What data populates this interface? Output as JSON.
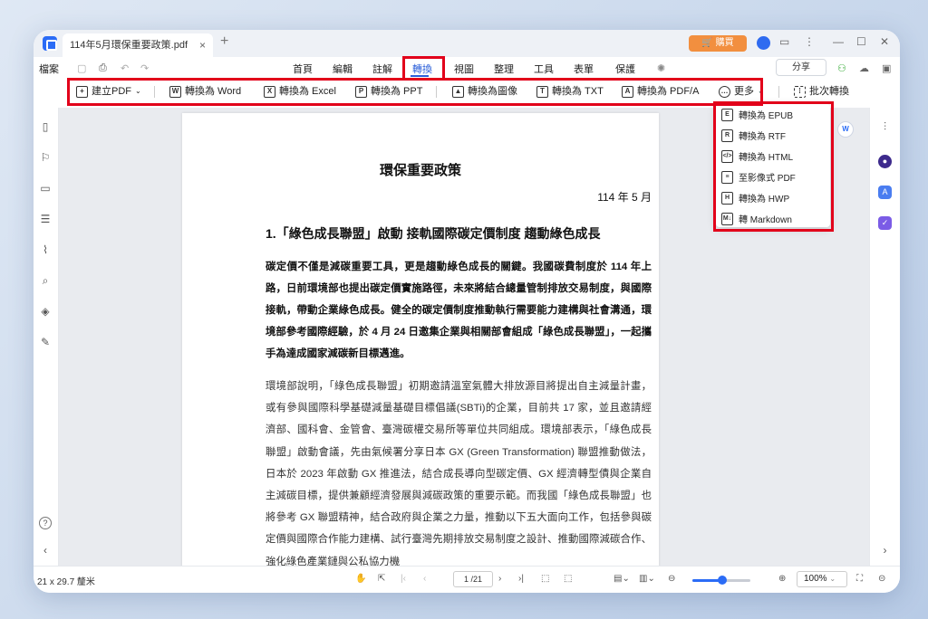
{
  "tab": {
    "title": "114年5月環保重要政策.pdf",
    "close": "×",
    "new": "+"
  },
  "window": {
    "buy_label": "購買",
    "avatar_letter": "8"
  },
  "menu": {
    "file_label": "檔案",
    "items": [
      "首頁",
      "編輯",
      "註解",
      "轉換",
      "視圖",
      "整理",
      "工具",
      "表單",
      "保護"
    ],
    "active": "轉換",
    "share_label": "分享"
  },
  "toolbar": {
    "create_pdf": "建立PDF",
    "to_word": "轉換為 Word",
    "to_excel": "轉換為 Excel",
    "to_ppt": "轉換為 PPT",
    "to_image": "轉換為圖像",
    "to_txt": "轉換為 TXT",
    "to_pdfa": "轉換為 PDF/A",
    "more": "更多",
    "batch": "批次轉換"
  },
  "more_menu": [
    {
      "label": "轉換為 EPUB",
      "icon_text": "E"
    },
    {
      "label": "轉換為 RTF",
      "icon_text": "R"
    },
    {
      "label": "轉換為 HTML",
      "icon_text": "</>"
    },
    {
      "label": "至影像式 PDF",
      "icon_text": "≡"
    },
    {
      "label": "轉換為 HWP",
      "icon_text": "H"
    },
    {
      "label": "轉 Markdown",
      "icon_text": "M↓"
    }
  ],
  "document": {
    "title": "環保重要政策",
    "date": "114 年 5 月",
    "heading": "1.「綠色成長聯盟」啟動 接軌國際碳定價制度 趨動綠色成長",
    "bold_paragraph": "碳定價不僅是減碳重要工具，更是趨動綠色成長的關鍵。我國碳費制度於 114 年上路，日前環境部也提出碳定價實施路徑，未來將結合總量管制排放交易制度，與國際接軌，帶動企業綠色成長。健全的碳定價制度推動執行需要能力建構與社會溝通，環境部參考國際經驗，於 4 月 24 日邀集企業與相關部會組成「綠色成長聯盟」，一起攜手為達成國家減碳新目標邁進。",
    "paragraph": "環境部說明，「綠色成長聯盟」初期邀請溫室氣體大排放源目將提出自主減量計畫，或有參與國際科學基礎減量基礎目標倡議(SBTi)的企業，目前共 17 家，並且邀請經濟部、國科會、金管會、臺灣碳權交易所等單位共同組成。環境部表示，「綠色成長聯盟」啟動會議，先由氣候署分享日本 GX (Green Transformation) 聯盟推動做法，日本於 2023 年啟動 GX 推進法，結合成長導向型碳定價、GX 經濟轉型債與企業自主減碳目標，提供兼顧經濟發展與減碳政策的重要示範。而我國「綠色成長聯盟」也將參考 GX 聯盟精神，結合政府與企業之力量，推動以下五大面向工作，包括參與碳定價與國際合作能力建構、試行臺灣先期排放交易制度之設計、推動國際減碳合作、強化綠色產業鏈與公私協力機"
  },
  "status": {
    "page_size": "21 x 29.7 釐米",
    "page_indicator": "1 /21",
    "zoom": "100%",
    "zoom_level": 0.52
  },
  "colors": {
    "accent": "#2b6cf6",
    "highlight": "#e2001a",
    "buy": "#f28f3f"
  }
}
